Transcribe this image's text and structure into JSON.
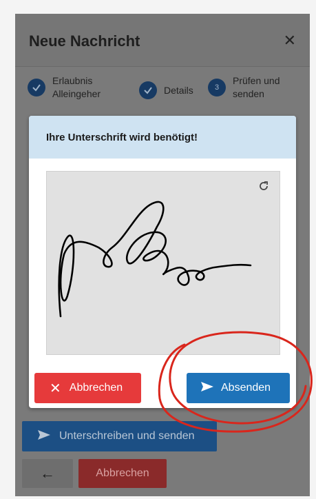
{
  "dialog": {
    "title": "Neue Nachricht",
    "close_icon": "close-icon",
    "steps": [
      {
        "label_line1": "Erlaubnis",
        "label_line2": "Alleingeher",
        "state": "done"
      },
      {
        "label_line1": "Details",
        "label_line2": "",
        "state": "done"
      },
      {
        "number": "3",
        "label_line1": "Prüfen und",
        "label_line2": "senden",
        "state": "current"
      }
    ],
    "footer": {
      "sign_send_label": "Unterschreiben und senden",
      "back_icon": "arrow-left-icon",
      "cancel_label": "Abbrechen"
    }
  },
  "signature_modal": {
    "title": "Ihre Unterschrift wird benötigt!",
    "refresh_icon": "refresh-icon",
    "cancel_label": "Abbrechen",
    "send_label": "Absenden",
    "cancel_icon": "close-icon",
    "send_icon": "send-icon"
  },
  "colors": {
    "primary": "#1e73b9",
    "danger": "#e63a3b",
    "modal_header": "#cfe3f2",
    "annotation": "#d9261c"
  }
}
